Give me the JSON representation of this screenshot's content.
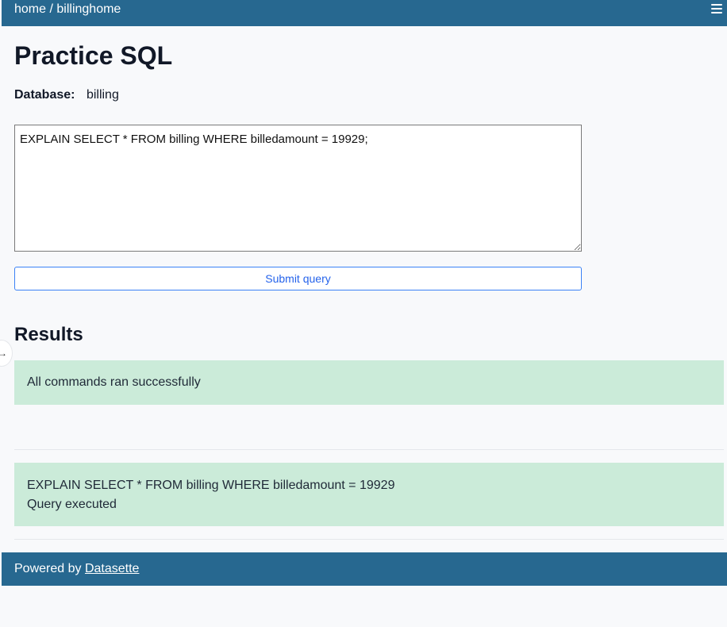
{
  "topbar": {
    "breadcrumb": {
      "home": "home",
      "separator": "/",
      "current": "billinghome"
    },
    "menu_icon": "hamburger-menu-icon"
  },
  "page": {
    "title": "Practice SQL"
  },
  "database": {
    "label": "Database:",
    "value": "billing"
  },
  "query": {
    "sql": "EXPLAIN SELECT * FROM billing WHERE billedamount = 19929;",
    "submit_label": "Submit query"
  },
  "results": {
    "heading": "Results",
    "success_message": "All commands ran successfully",
    "executed_sql": "EXPLAIN SELECT * FROM billing WHERE billedamount = 19929",
    "executed_status": "Query executed"
  },
  "footer": {
    "prefix": "Powered by",
    "link_text": "Datasette"
  },
  "colors": {
    "bar": "#276890",
    "success_bg": "#cbebd9",
    "accent": "#2563eb"
  }
}
